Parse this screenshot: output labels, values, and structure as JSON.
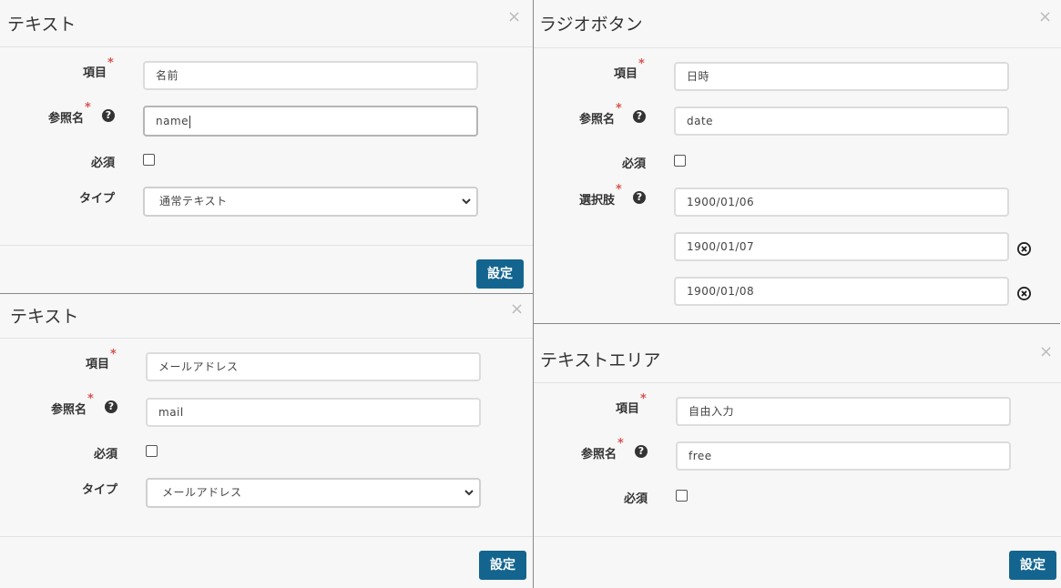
{
  "panels": [
    {
      "title": "テキスト",
      "fields": {
        "item_label": "項目",
        "item_value": "名前",
        "ref_label": "参照名",
        "ref_value": "name",
        "required_label": "必須",
        "type_label": "タイプ",
        "type_value": "通常テキスト"
      },
      "button": "設定"
    },
    {
      "title": "テキスト",
      "fields": {
        "item_label": "項目",
        "item_value": "メールアドレス",
        "ref_label": "参照名",
        "ref_value": "mail",
        "required_label": "必須",
        "type_label": "タイプ",
        "type_value": "メールアドレス"
      },
      "button": "設定"
    },
    {
      "title": "ラジオボタン",
      "fields": {
        "item_label": "項目",
        "item_value": "日時",
        "ref_label": "参照名",
        "ref_value": "date",
        "required_label": "必須",
        "choices_label": "選択肢",
        "choices": [
          "1900/01/06",
          "1900/01/07",
          "1900/01/08"
        ]
      }
    },
    {
      "title": "テキストエリア",
      "fields": {
        "item_label": "項目",
        "item_value": "自由入力",
        "ref_label": "参照名",
        "ref_value": "free",
        "required_label": "必須"
      },
      "button": "設定"
    }
  ],
  "required_mark": "*",
  "help_glyph": "?",
  "close_glyph": "×"
}
